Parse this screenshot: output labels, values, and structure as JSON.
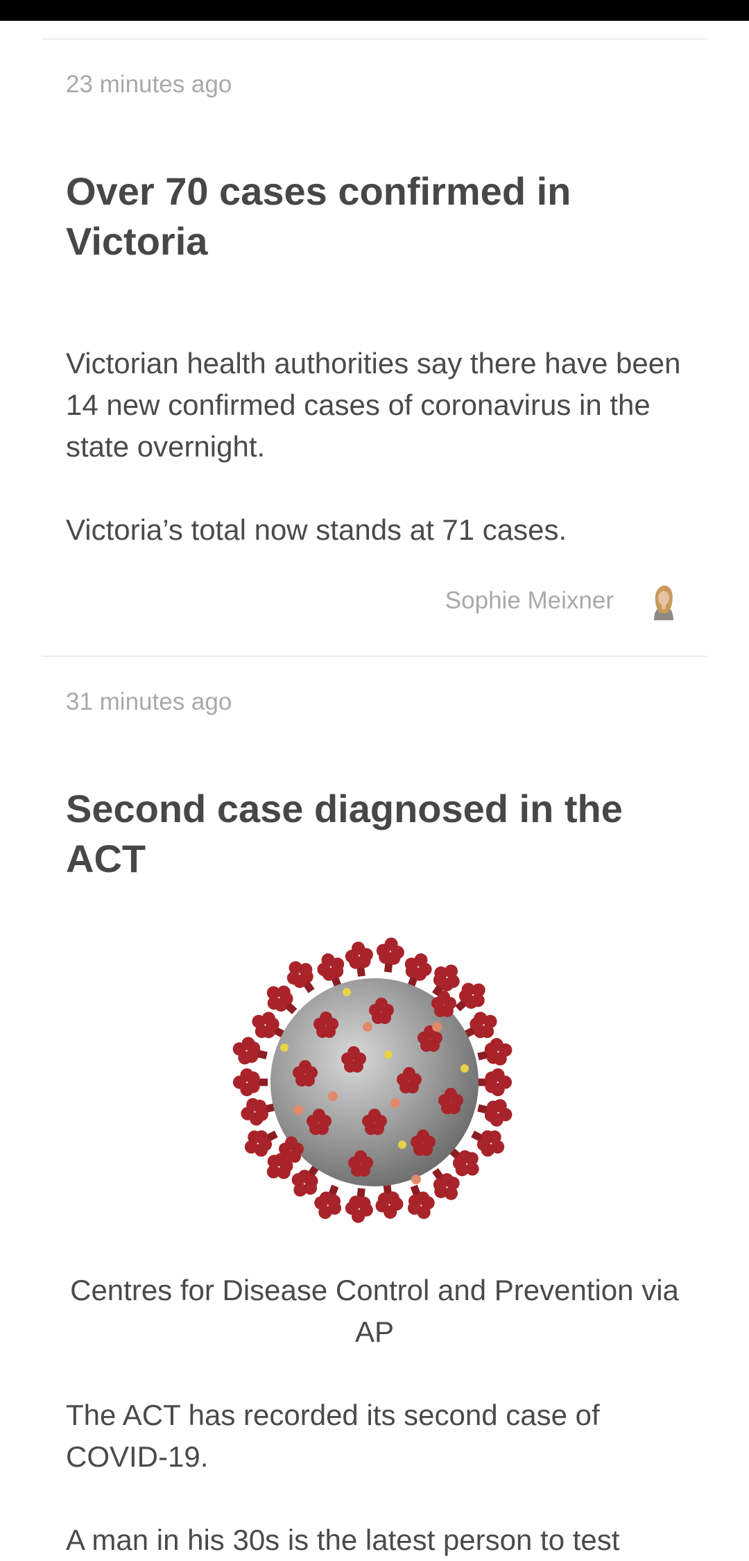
{
  "posts": [
    {
      "timestamp": "23 minutes ago",
      "headline": "Over 70 cases confirmed in Victoria",
      "paragraphs": [
        "Victorian health authorities say there have been 14 new confirmed cases of coronavirus in the state overnight.",
        "Victoria’s total now stands at 71 cases."
      ],
      "author": "Sophie Meixner"
    },
    {
      "timestamp": "31 minutes ago",
      "headline": "Second case diagnosed in the ACT",
      "image_caption": "Centres for Disease Control and Prevention via AP",
      "paragraphs": [
        "The ACT has recorded its second case of COVID-19.",
        "A man in his 30s is the latest person to test"
      ]
    }
  ],
  "colors": {
    "status_bar": "#000000",
    "divider": "#ececec",
    "muted_text": "#a9a9a9",
    "body_text": "#4a4a4a",
    "virus_spike": "#a8242a",
    "virus_body": "#9a9a9a"
  }
}
